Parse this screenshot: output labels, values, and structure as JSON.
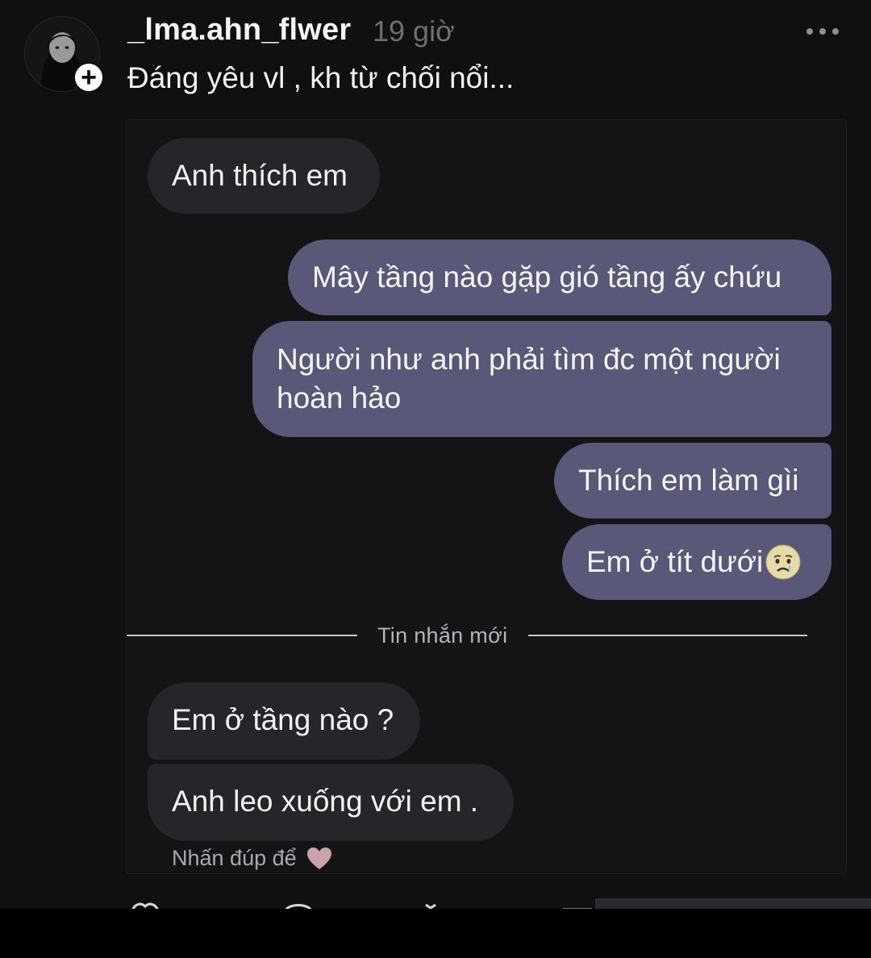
{
  "post": {
    "username": "_lma.ahn_flwer",
    "time_ago": "19 giờ",
    "caption": "Đáng yêu vl , kh từ chối nổi...",
    "follow_symbol": "+"
  },
  "chat": {
    "messages": [
      {
        "side": "incoming",
        "text": "Anh thích em"
      },
      {
        "side": "outgoing",
        "text": "Mây tầng nào gặp gió tầng ấy chứu"
      },
      {
        "side": "outgoing",
        "line1": "Người như anh phải tìm đc một người",
        "line2": "hoàn hảo"
      },
      {
        "side": "outgoing",
        "text": "Thích em làm gìi"
      },
      {
        "side": "outgoing",
        "text": "Em ở tít dưới",
        "emoji": "crying-face-icon"
      },
      {
        "side": "incoming",
        "text": "Em ở tầng nào ?"
      },
      {
        "side": "incoming",
        "text": "Anh leo xuống với em ."
      }
    ],
    "new_messages_label": "Tin nhắn mới",
    "double_tap_hint": "Nhấn đúp để",
    "double_tap_icon": "heart-icon"
  },
  "colors": {
    "background": "#101012",
    "incoming_bubble": "#25252a",
    "outgoing_bubble": "#5a5878",
    "muted_text": "#6e6e73"
  }
}
